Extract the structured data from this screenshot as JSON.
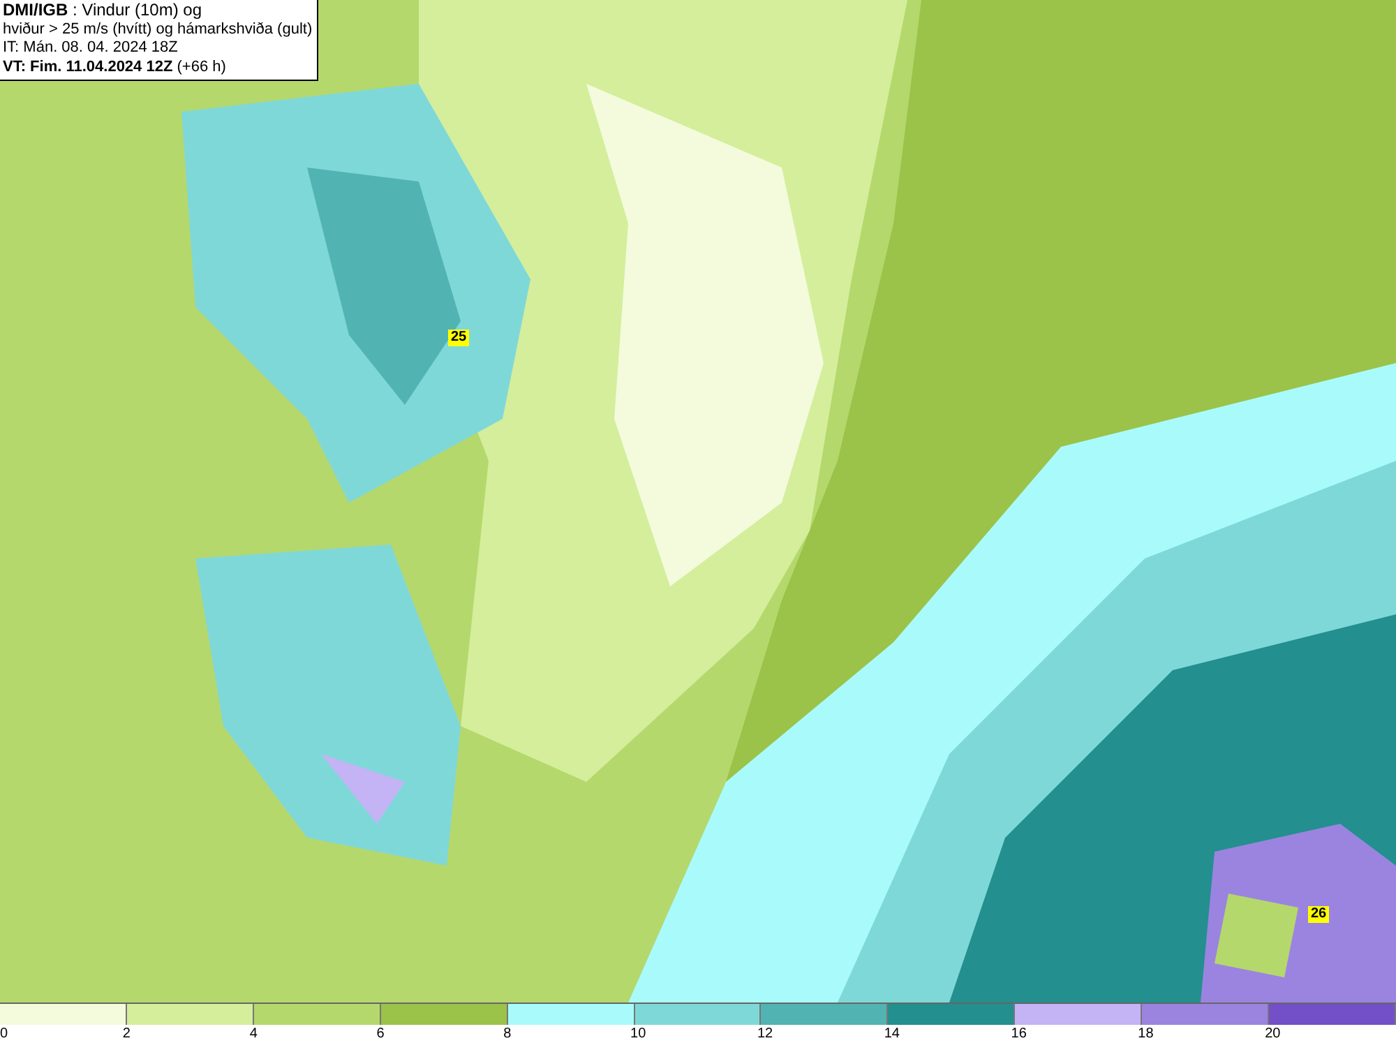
{
  "header": {
    "lines": [
      "**DMI/IGB** : Vindur (10m) og",
      "hviður > 25 m/s (hvítt) og hámarkshviða (gult)",
      "IT: Mán. 08. 04. 2024 18Z",
      "**VT: Fim. 11.04.2024 12Z** (+66 h)"
    ]
  },
  "gust_markers": [
    "25",
    "26"
  ],
  "legend": {
    "segments": [
      {
        "color": "#f3fbdc"
      },
      {
        "color": "#d4ee9c"
      },
      {
        "color": "#b5d86c"
      },
      {
        "color": "#9bc249"
      },
      {
        "color": "#a9fbfb"
      },
      {
        "color": "#7fd8d8"
      },
      {
        "color": "#52b3b3"
      },
      {
        "color": "#238f8f"
      },
      {
        "color": "#c4b3f5"
      },
      {
        "color": "#9b84e0"
      },
      {
        "color": "#7450c8"
      }
    ],
    "labels": [
      "0",
      "2",
      "4",
      "6",
      "8",
      "10",
      "12",
      "14",
      "16",
      "18",
      "20"
    ]
  }
}
